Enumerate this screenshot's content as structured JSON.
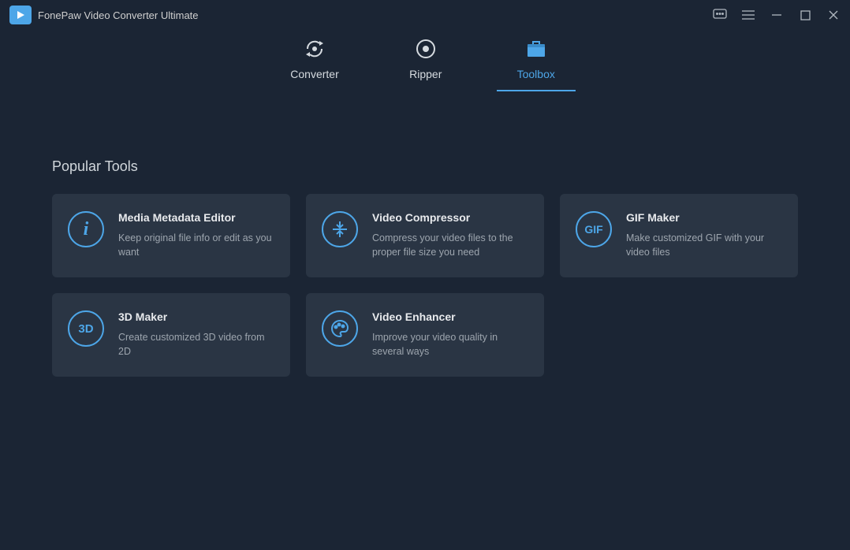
{
  "app": {
    "title": "FonePaw Video Converter Ultimate"
  },
  "nav": {
    "items": [
      {
        "label": "Converter"
      },
      {
        "label": "Ripper"
      },
      {
        "label": "Toolbox"
      }
    ]
  },
  "section": {
    "title": "Popular Tools"
  },
  "tools": [
    {
      "title": "Media Metadata Editor",
      "desc": "Keep original file info or edit as you want",
      "icon_text": "i"
    },
    {
      "title": "Video Compressor",
      "desc": "Compress your video files to the proper file size you need",
      "icon_text": ""
    },
    {
      "title": "GIF Maker",
      "desc": "Make customized GIF with your video files",
      "icon_text": "GIF"
    },
    {
      "title": "3D Maker",
      "desc": "Create customized 3D video from 2D",
      "icon_text": "3D"
    },
    {
      "title": "Video Enhancer",
      "desc": "Improve your video quality in several ways",
      "icon_text": ""
    }
  ]
}
